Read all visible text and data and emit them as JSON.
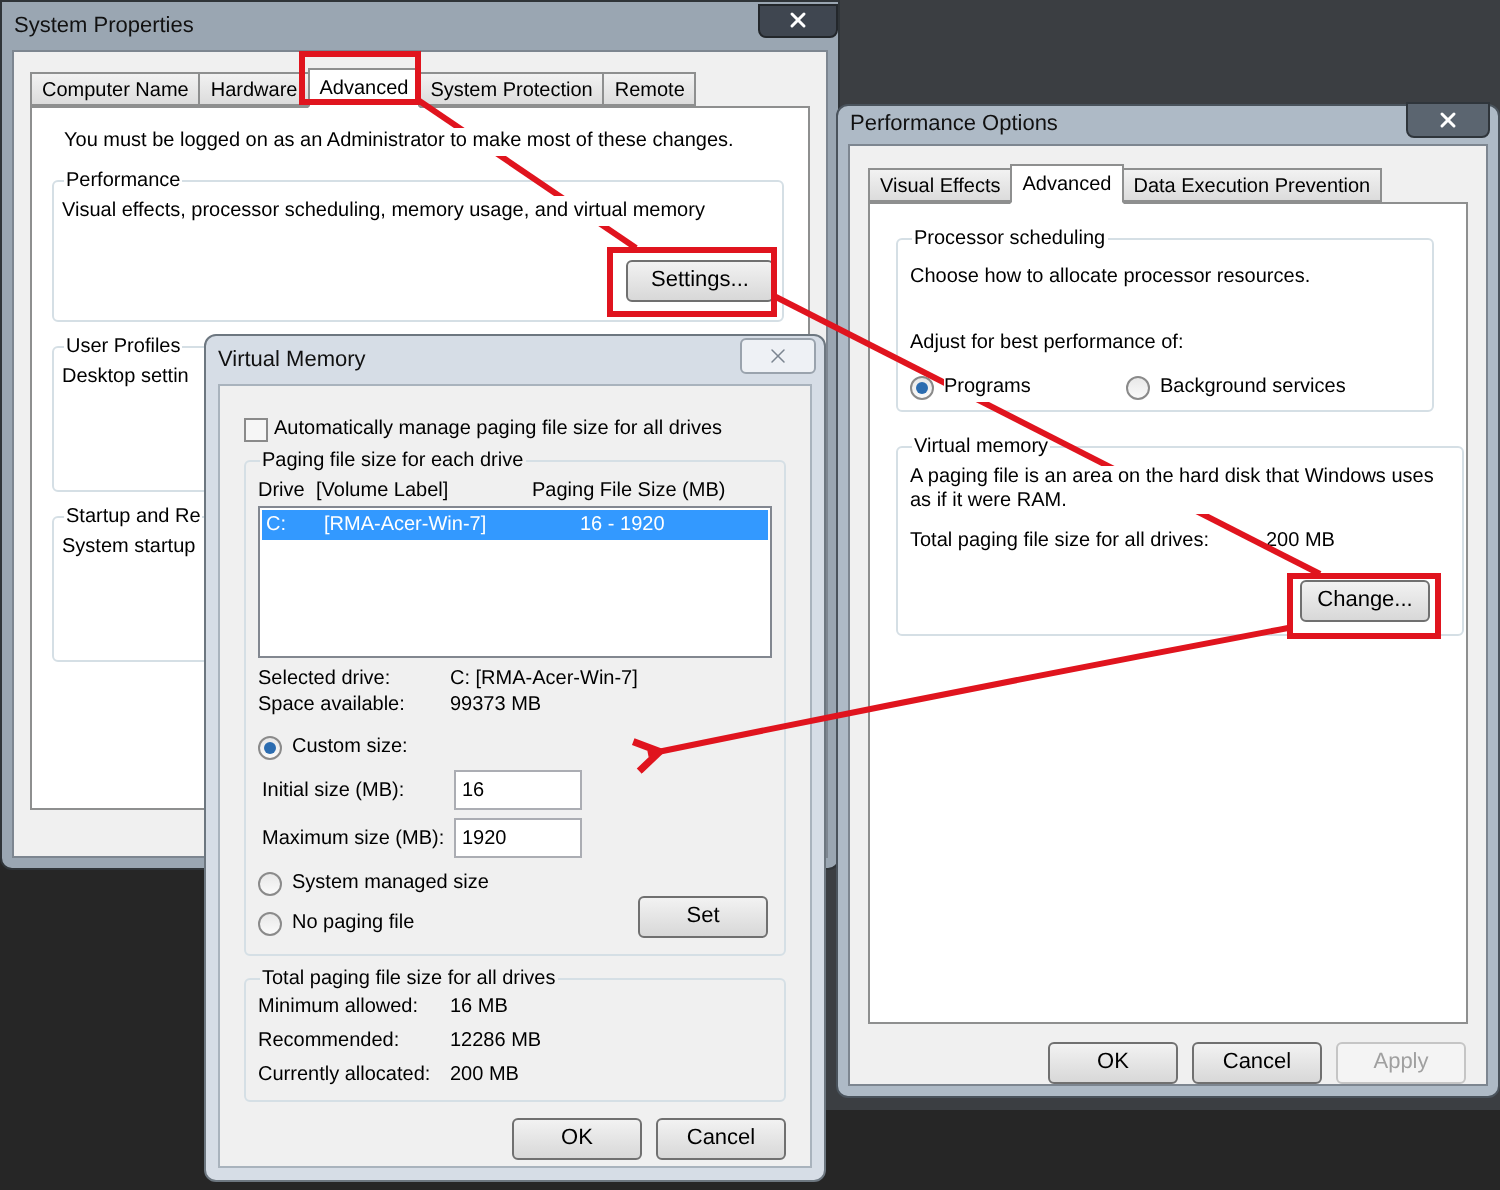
{
  "system_properties": {
    "title": "System Properties",
    "tabs": [
      {
        "label": "Computer Name",
        "selected": false
      },
      {
        "label": "Hardware",
        "selected": false
      },
      {
        "label": "Advanced",
        "selected": true
      },
      {
        "label": "System Protection",
        "selected": false
      },
      {
        "label": "Remote",
        "selected": false
      }
    ],
    "notice": "You must be logged on as an Administrator to make most of these changes.",
    "groups": [
      {
        "title": "Performance",
        "text": "Visual effects, processor scheduling, memory usage, and virtual memory",
        "button": "Settings..."
      },
      {
        "title": "User Profiles",
        "text": "Desktop settin"
      },
      {
        "title": "Startup and Re",
        "text": "System startup"
      }
    ]
  },
  "virtual_memory": {
    "title": "Virtual Memory",
    "auto_manage": {
      "label": "Automatically manage paging file size for all drives",
      "checked": false
    },
    "drives_group": {
      "title": "Paging file size for each drive",
      "columns": [
        "Drive",
        "[Volume Label]",
        "Paging File Size (MB)"
      ],
      "rows": [
        {
          "drive": "C:",
          "label": "[RMA-Acer-Win-7]",
          "size": "16 - 1920",
          "selected": true
        }
      ]
    },
    "details": [
      {
        "label": "Selected drive:",
        "value": "C:  [RMA-Acer-Win-7]"
      },
      {
        "label": "Space available:",
        "value": "99373 MB"
      }
    ],
    "options": [
      {
        "label": "Custom size:",
        "selected": true
      },
      {
        "label": "System managed size",
        "selected": false
      },
      {
        "label": "No paging file",
        "selected": false
      }
    ],
    "fields": [
      {
        "label": "Initial size (MB):",
        "value": "16"
      },
      {
        "label": "Maximum size (MB):",
        "value": "1920"
      }
    ],
    "set_button": "Set",
    "totals": {
      "title": "Total paging file size for all drives",
      "rows": [
        {
          "label": "Minimum allowed:",
          "value": "16 MB"
        },
        {
          "label": "Recommended:",
          "value": "12286 MB"
        },
        {
          "label": "Currently allocated:",
          "value": "200 MB"
        }
      ]
    },
    "buttons": [
      "OK",
      "Cancel"
    ]
  },
  "performance_options": {
    "title": "Performance Options",
    "tabs": [
      {
        "label": "Visual Effects",
        "selected": false
      },
      {
        "label": "Advanced",
        "selected": true
      },
      {
        "label": "Data Execution Prevention",
        "selected": false
      }
    ],
    "processor": {
      "title": "Processor scheduling",
      "text": "Choose how to allocate processor resources.",
      "adjust": "Adjust for best performance of:",
      "options": [
        {
          "label": "Programs",
          "selected": true
        },
        {
          "label": "Background services",
          "selected": false
        }
      ]
    },
    "memory": {
      "title": "Virtual memory",
      "text": "A paging file is an area on the hard disk that Windows uses as if it were RAM.",
      "total_label": "Total paging file size for all drives:",
      "total_value": "200 MB",
      "button": "Change..."
    },
    "buttons": [
      {
        "label": "OK",
        "disabled": false
      },
      {
        "label": "Cancel",
        "disabled": false
      },
      {
        "label": "Apply",
        "disabled": true
      }
    ]
  }
}
